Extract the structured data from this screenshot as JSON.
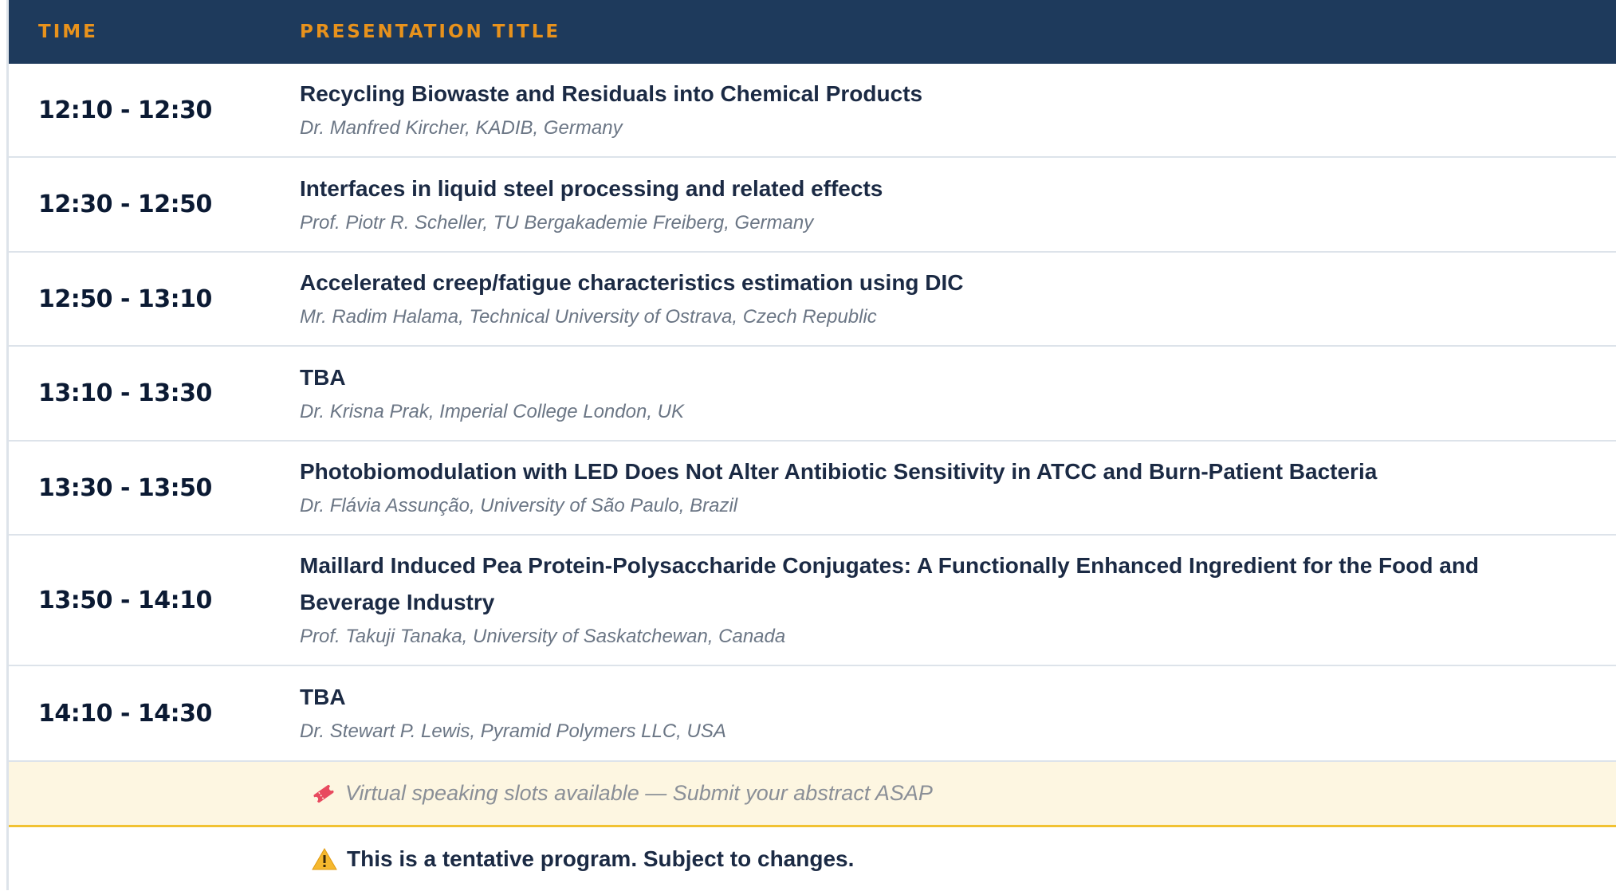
{
  "header": {
    "time_label": "TIME",
    "title_label": "PRESENTATION TITLE"
  },
  "sessions": [
    {
      "time": "12:10 - 12:30",
      "title": "Recycling Biowaste and Residuals into Chemical Products",
      "speaker": "Dr. Manfred Kircher, KADIB, Germany"
    },
    {
      "time": "12:30 - 12:50",
      "title": "Interfaces in liquid steel processing and related effects",
      "speaker": "Prof. Piotr R. Scheller, TU Bergakademie Freiberg, Germany"
    },
    {
      "time": "12:50 - 13:10",
      "title": "Accelerated creep/fatigue characteristics estimation using DIC",
      "speaker": "Mr. Radim Halama, Technical University of Ostrava, Czech Republic"
    },
    {
      "time": "13:10 - 13:30",
      "title": "TBA",
      "speaker": "Dr. Krisna Prak, Imperial College London, UK"
    },
    {
      "time": "13:30 - 13:50",
      "title": "Photobiomodulation with LED Does Not Alter Antibiotic Sensitivity in ATCC and Burn-Patient Bacteria",
      "speaker": "Dr. Flávia Assunção, University of São Paulo, Brazil"
    },
    {
      "time": "13:50 - 14:10",
      "title": "Maillard Induced Pea Protein-Polysaccharide Conjugates: A Functionally Enhanced Ingredient for the Food and Beverage Industry",
      "speaker": "Prof. Takuji Tanaka, University of Saskatchewan, Canada"
    },
    {
      "time": "14:10 - 14:30",
      "title": "TBA",
      "speaker": "Dr. Stewart P. Lewis, Pyramid Polymers LLC, USA"
    }
  ],
  "notice": {
    "icon": "ticket-icon",
    "text": "Virtual speaking slots available — Submit your abstract ASAP"
  },
  "warning": {
    "icon": "warning-icon",
    "text": "This is a tentative program. Subject to changes."
  },
  "colors": {
    "header_bg": "#1e3a5c",
    "header_text": "#e8921c",
    "notice_bg": "#fdf6e1",
    "notice_border": "#f1c232"
  }
}
